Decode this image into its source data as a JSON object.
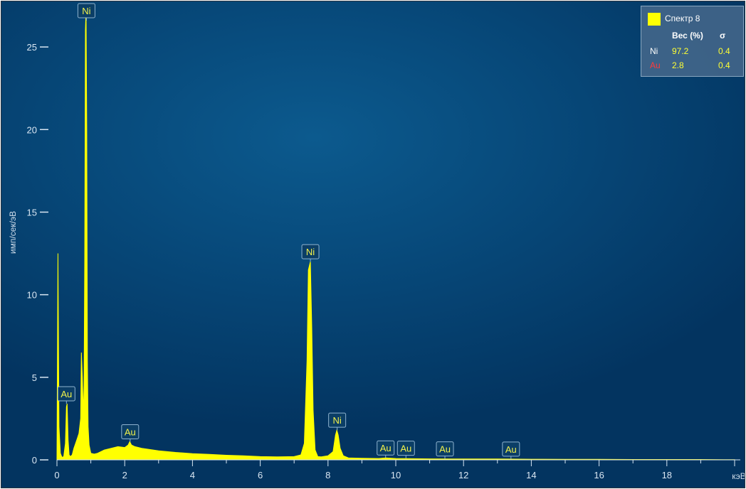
{
  "chart_data": {
    "type": "line",
    "xlabel": "кэВ",
    "ylabel": "имп/сек/эВ",
    "xlim": [
      0,
      20
    ],
    "ylim": [
      0,
      27.5
    ],
    "x_ticks": [
      0,
      2,
      4,
      6,
      8,
      10,
      12,
      14,
      16,
      18
    ],
    "y_ticks": [
      0,
      5,
      10,
      15,
      20,
      25
    ],
    "series": [
      {
        "name": "Спектр 8",
        "color": "#ffff00",
        "x": [
          0.0,
          0.03,
          0.06,
          0.1,
          0.15,
          0.2,
          0.25,
          0.28,
          0.3,
          0.33,
          0.36,
          0.4,
          0.45,
          0.5,
          0.55,
          0.6,
          0.65,
          0.7,
          0.72,
          0.75,
          0.78,
          0.8,
          0.82,
          0.84,
          0.86,
          0.88,
          0.9,
          0.92,
          0.95,
          1.0,
          1.1,
          1.2,
          1.4,
          1.6,
          1.8,
          2.0,
          2.1,
          2.15,
          2.2,
          2.3,
          2.5,
          3.0,
          3.5,
          4.0,
          4.5,
          5.0,
          5.5,
          6.0,
          6.5,
          7.0,
          7.2,
          7.3,
          7.38,
          7.42,
          7.48,
          7.52,
          7.56,
          7.62,
          7.7,
          7.8,
          8.0,
          8.15,
          8.22,
          8.26,
          8.3,
          8.36,
          8.45,
          8.6,
          9.0,
          9.5,
          9.7,
          10.0,
          11.0,
          12.0,
          13.0,
          14.0,
          15.0,
          16.0,
          17.0,
          18.0,
          19.0,
          20.0
        ],
        "y": [
          0.0,
          12.5,
          2.0,
          0.4,
          0.15,
          0.2,
          1.0,
          3.2,
          3.4,
          1.2,
          0.3,
          0.2,
          0.3,
          0.7,
          1.0,
          1.3,
          1.6,
          2.5,
          6.5,
          5.0,
          2.8,
          4.5,
          12.0,
          26.0,
          27.3,
          20.0,
          6.0,
          2.0,
          0.9,
          0.4,
          0.35,
          0.4,
          0.6,
          0.7,
          0.8,
          0.75,
          0.9,
          1.1,
          0.9,
          0.8,
          0.7,
          0.55,
          0.45,
          0.38,
          0.33,
          0.28,
          0.25,
          0.2,
          0.18,
          0.2,
          0.3,
          1.0,
          6.0,
          11.5,
          12.0,
          8.0,
          3.0,
          0.6,
          0.2,
          0.18,
          0.25,
          0.5,
          1.5,
          1.8,
          1.5,
          0.7,
          0.25,
          0.12,
          0.1,
          0.08,
          0.12,
          0.08,
          0.06,
          0.05,
          0.05,
          0.04,
          0.03,
          0.03,
          0.02,
          0.02,
          0.02,
          0.01
        ]
      }
    ],
    "peak_labels": [
      {
        "text": "Ni",
        "x": 0.87,
        "y": 27.3
      },
      {
        "text": "Au",
        "x": 0.28,
        "y": 3.4
      },
      {
        "text": "Au",
        "x": 2.16,
        "y": 1.1
      },
      {
        "text": "Ni",
        "x": 7.48,
        "y": 12.0
      },
      {
        "text": "Ni",
        "x": 8.27,
        "y": 1.8
      },
      {
        "text": "Au",
        "x": 9.7,
        "y": 0.12
      },
      {
        "text": "Au",
        "x": 10.3,
        "y": 0.1
      },
      {
        "text": "Au",
        "x": 11.45,
        "y": 0.06
      },
      {
        "text": "Au",
        "x": 13.4,
        "y": 0.05
      }
    ]
  },
  "legend": {
    "series_name": "Спектр 8",
    "swatch_color": "#ffff00",
    "col_weight": "Вес (%)",
    "col_sigma": "σ",
    "rows": [
      {
        "element": "Ni",
        "weight": "97.2",
        "sigma": "0.4",
        "color": "#ffffff"
      },
      {
        "element": "Au",
        "weight": "2.8",
        "sigma": "0.4",
        "color": "#ff3b3b"
      }
    ]
  }
}
